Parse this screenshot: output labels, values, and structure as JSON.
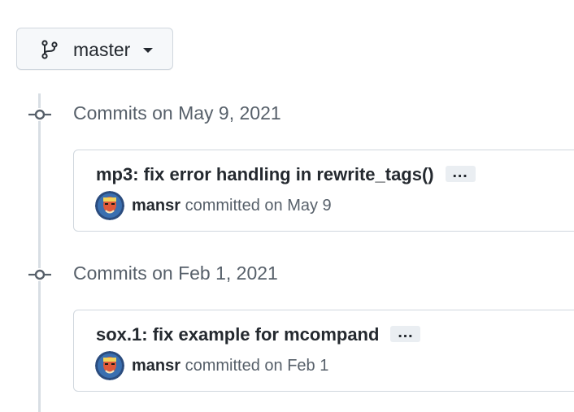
{
  "branch": {
    "name": "master",
    "icon": "git-branch-icon"
  },
  "groups": [
    {
      "heading": "Commits on May 9, 2021",
      "commits": [
        {
          "title": "mp3: fix error handling in rewrite_tags()",
          "ellipsis": "…",
          "author": "mansr",
          "action": "committed",
          "date": "on May 9"
        }
      ]
    },
    {
      "heading": "Commits on Feb 1, 2021",
      "commits": [
        {
          "title": "sox.1: fix example for mcompand",
          "ellipsis": "…",
          "author": "mansr",
          "action": "committed",
          "date": "on Feb 1"
        }
      ]
    }
  ],
  "colors": {
    "text": "#24292f",
    "muted": "#57606a",
    "border": "#d0d7de",
    "timeline": "#d8dee4"
  }
}
